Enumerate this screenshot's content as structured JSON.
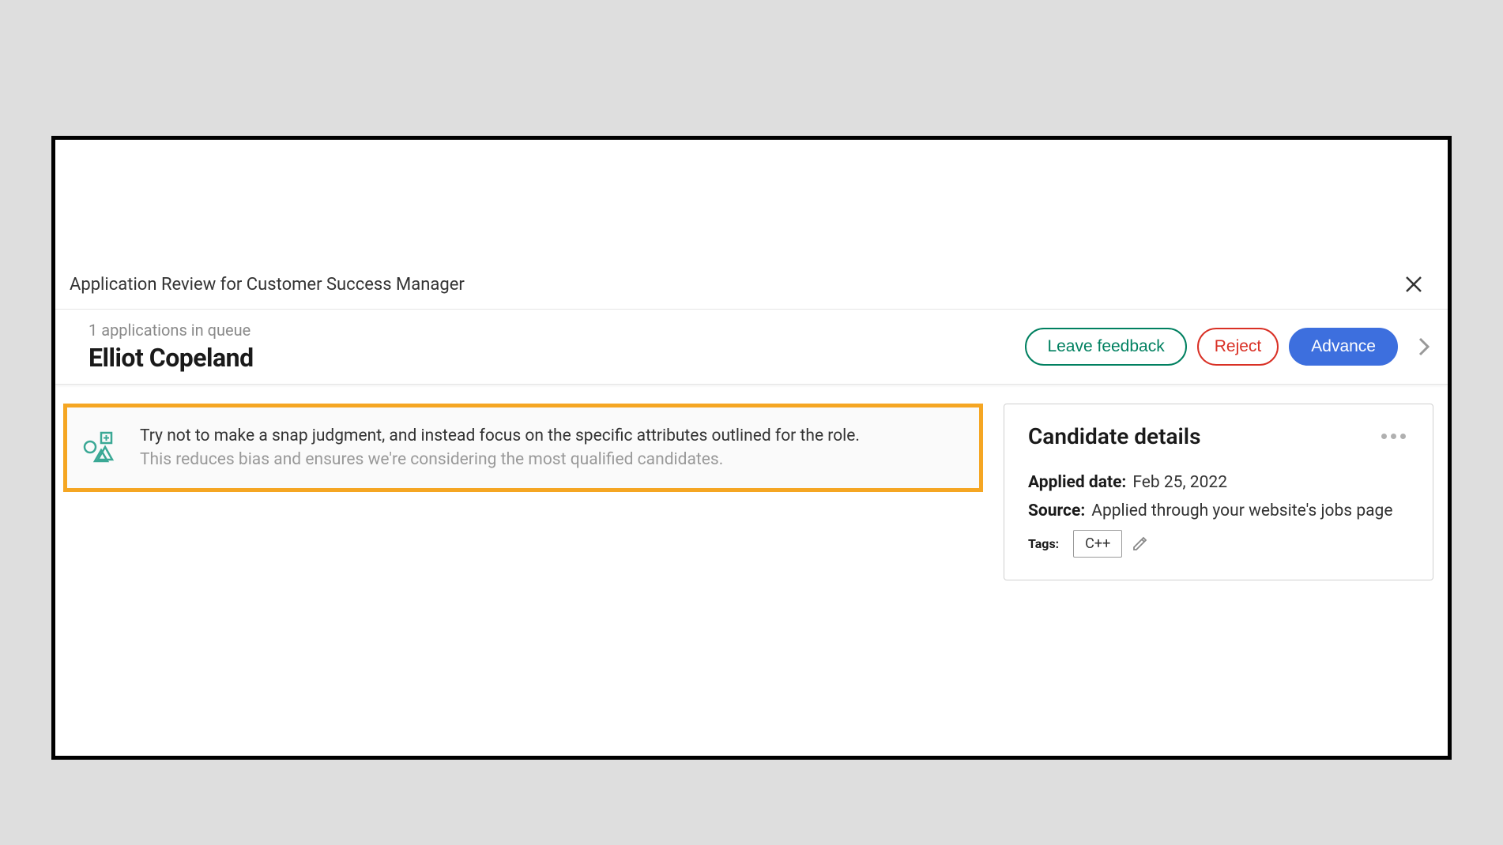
{
  "header": {
    "title": "Application Review for Customer Success Manager"
  },
  "candidate": {
    "queue_text": "1 applications in queue",
    "name": "Elliot Copeland"
  },
  "actions": {
    "feedback_label": "Leave feedback",
    "reject_label": "Reject",
    "advance_label": "Advance"
  },
  "banner": {
    "primary": "Try not to make a snap judgment, and instead focus on the specific attributes outlined for the role.",
    "secondary": "This reduces bias and ensures we're considering the most qualified candidates."
  },
  "details": {
    "panel_title": "Candidate details",
    "applied_label": "Applied date:",
    "applied_value": "Feb 25, 2022",
    "source_label": "Source:",
    "source_value": "Applied through your website's jobs page",
    "tags_label": "Tags:",
    "tags": [
      "C++"
    ]
  }
}
